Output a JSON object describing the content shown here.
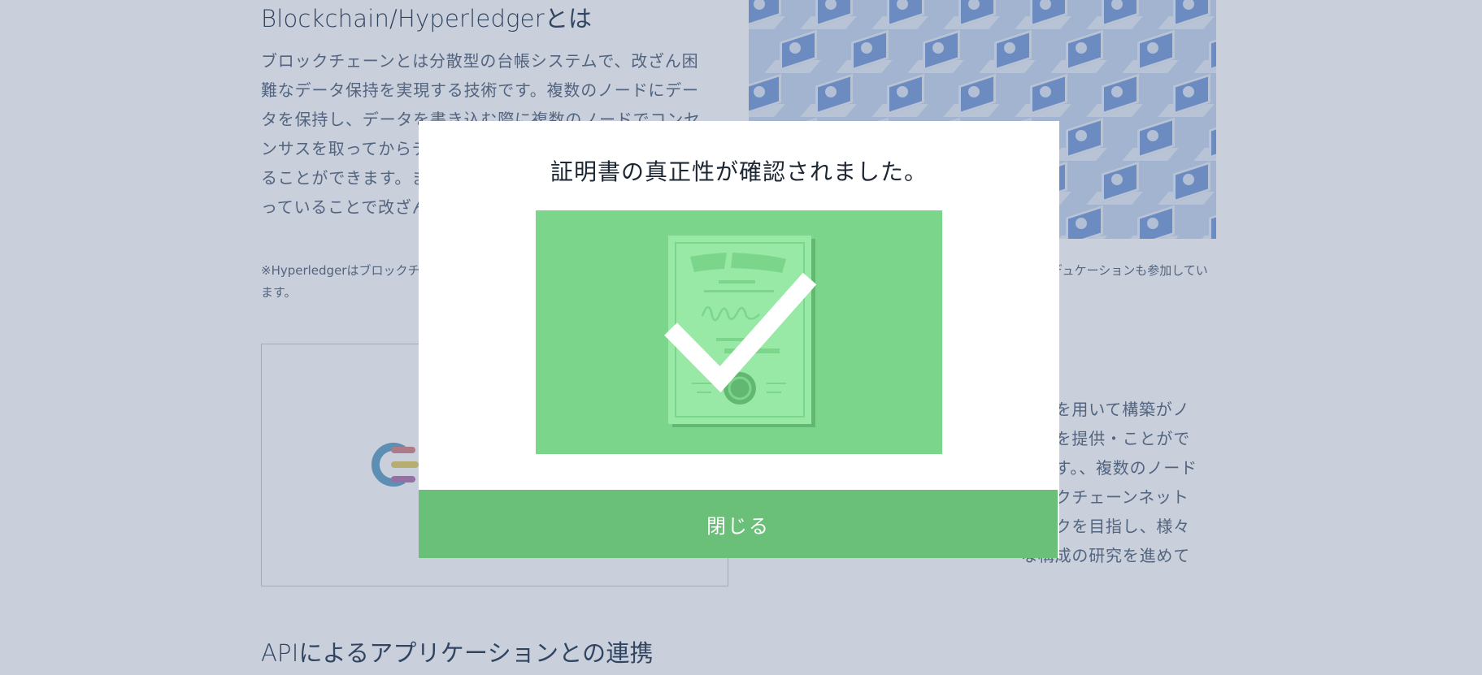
{
  "background_page": {
    "section1_heading": "Blockchain/Hyperledgerとは",
    "section1_paragraph": "ブロックチェーンとは分散型の台帳システムで、改ざん困難なデータ保持を実現する技術です。複数のノードにデータを保持し、データを書き込む際に複数のノードでコンセンサスを取ってからデータを書き込むことで信頼性を高めることができます。またデータがハッシュによってつながっていることで改ざん耐性を高めていることも特徴です。",
    "section1_note": "※Hyperledgerはブロックチェーン技術の推進を目的としたオープンソースプロジェクトとして開発が進められています。ソニー・グローバルエデュケーションも参加しています。",
    "section2_paragraph": "ードを用いて構築がノードを提供・ことができます。、複数のノードがックチェーンネットワークを目指し、様々な構成の研究を進めています。",
    "section3_heading": "APIによるアプリケーションとの連携"
  },
  "modal": {
    "title": "証明書の真正性が確認されました。",
    "close_label": "閉じる",
    "illustration": "certificate-verified-check-icon"
  },
  "colors": {
    "overlay": "#3e5580",
    "modal_bg": "#ffffff",
    "illustration_bg": "#7bd68b",
    "certificate": "#98e8a6",
    "check": "#ffffff",
    "close_button": "#6bc079",
    "hero_bg": "#c9d8ef"
  }
}
